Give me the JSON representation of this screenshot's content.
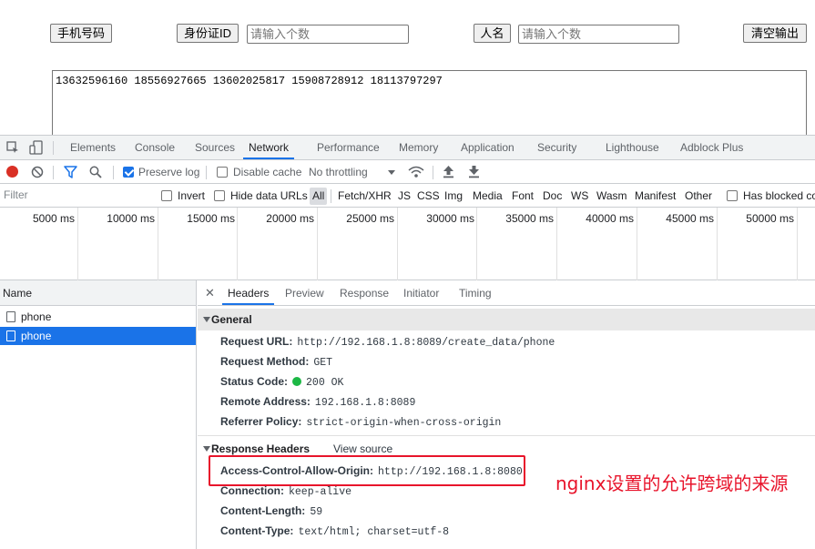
{
  "page": {
    "phone_button": "手机号码",
    "idcard_button": "身份证ID",
    "idcard_placeholder": "请输入个数",
    "name_button": "人名",
    "name_placeholder": "请输入个数",
    "clear_button": "清空输出",
    "output_text": "13632596160 18556927665 13602025817 15908728912 18113797297"
  },
  "devtools": {
    "panel_tabs": [
      "Elements",
      "Console",
      "Sources",
      "Network",
      "Performance",
      "Memory",
      "Application",
      "Security",
      "Lighthouse",
      "Adblock Plus"
    ],
    "active_panel": "Network",
    "toolbar": {
      "preserve_log": "Preserve log",
      "preserve_log_checked": true,
      "disable_cache": "Disable cache",
      "disable_cache_checked": false,
      "throttling": "No throttling"
    },
    "filter": {
      "placeholder": "Filter",
      "invert": "Invert",
      "hide_data_urls": "Hide data URLs",
      "types": [
        "All",
        "Fetch/XHR",
        "JS",
        "CSS",
        "Img",
        "Media",
        "Font",
        "Doc",
        "WS",
        "Wasm",
        "Manifest",
        "Other"
      ],
      "active_type": "All",
      "has_blocked": "Has blocked cookies"
    },
    "timeline_ticks": [
      "5000 ms",
      "10000 ms",
      "15000 ms",
      "20000 ms",
      "25000 ms",
      "30000 ms",
      "35000 ms",
      "40000 ms",
      "45000 ms",
      "50000 ms"
    ],
    "requests": {
      "header": "Name",
      "items": [
        "phone",
        "phone"
      ],
      "selected_index": 1
    },
    "detail_tabs": [
      "Headers",
      "Preview",
      "Response",
      "Initiator",
      "Timing"
    ],
    "active_detail_tab": "Headers",
    "general": {
      "title": "General",
      "rows": [
        {
          "key": "Request URL:",
          "value": "http://192.168.1.8:8089/create_data/phone"
        },
        {
          "key": "Request Method:",
          "value": "GET"
        },
        {
          "key": "Status Code:",
          "value": "200 OK"
        },
        {
          "key": "Remote Address:",
          "value": "192.168.1.8:8089"
        },
        {
          "key": "Referrer Policy:",
          "value": "strict-origin-when-cross-origin"
        }
      ]
    },
    "response_headers": {
      "title": "Response Headers",
      "view_source": "View source",
      "rows": [
        {
          "key": "Access-Control-Allow-Origin:",
          "value": "http://192.168.1.8:8080"
        },
        {
          "key": "Connection:",
          "value": "keep-alive"
        },
        {
          "key": "Content-Length:",
          "value": "59"
        },
        {
          "key": "Content-Type:",
          "value": "text/html; charset=utf-8"
        }
      ]
    }
  },
  "annotation": {
    "text": "nginx设置的允许跨域的来源",
    "color": "#e8142b"
  }
}
